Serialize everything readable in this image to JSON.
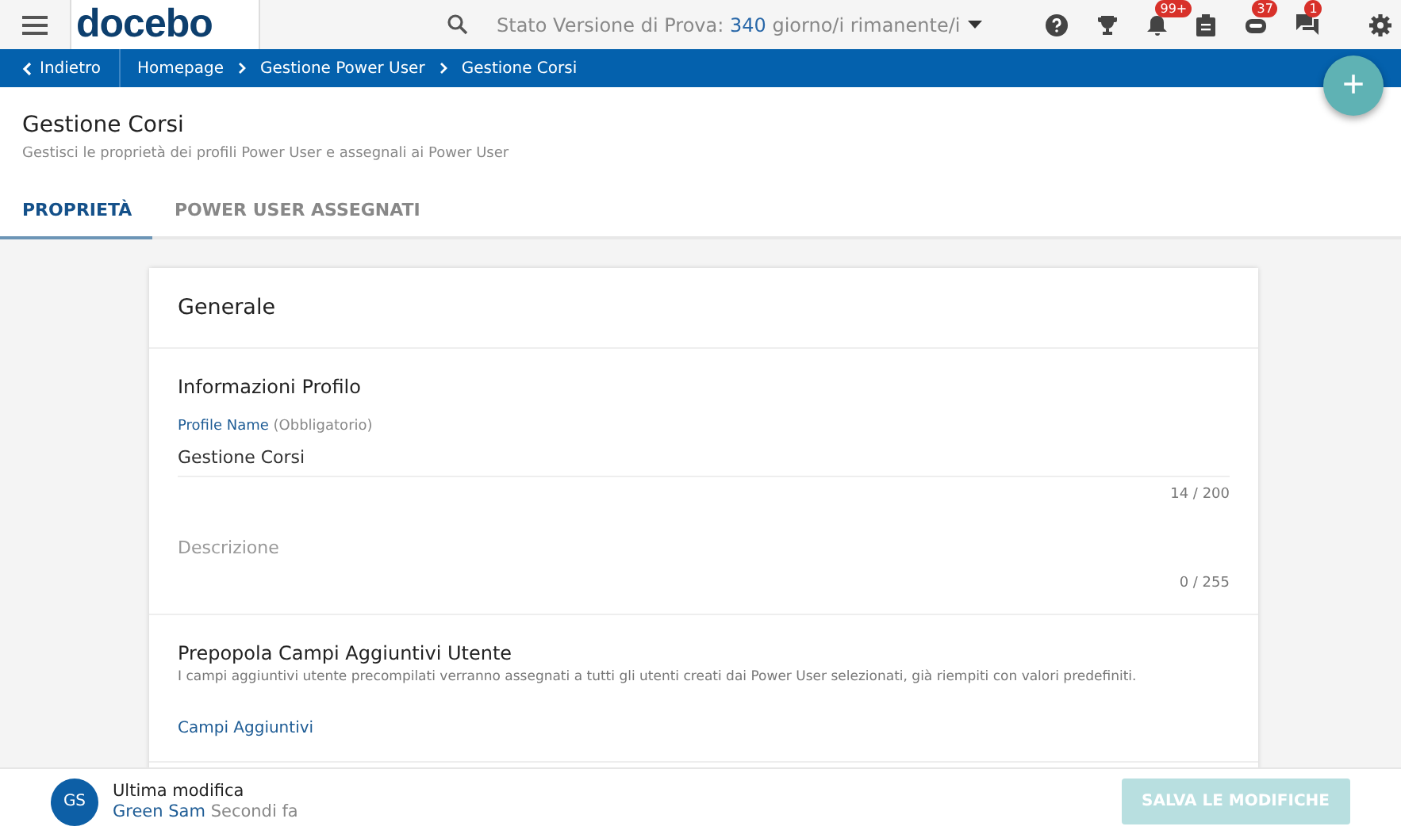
{
  "header": {
    "logo": "docebo",
    "trial": {
      "prefix": "Stato Versione di Prova:",
      "days": "340",
      "suffix": "giorno/i rimanente/i"
    },
    "icons": [
      {
        "kind": "help"
      },
      {
        "kind": "trophy"
      },
      {
        "kind": "bell",
        "badge": "99+"
      },
      {
        "kind": "clipboard"
      },
      {
        "kind": "bot",
        "badge": "37"
      },
      {
        "kind": "chat",
        "badge": "1"
      },
      {
        "kind": "settings"
      }
    ]
  },
  "breadcrumb": {
    "back": "Indietro",
    "items": [
      "Homepage",
      "Gestione Power User",
      "Gestione Corsi"
    ]
  },
  "fab": "+",
  "page": {
    "title": "Gestione Corsi",
    "subtitle": "Gestisci le proprietà dei profili Power User e assegnali ai Power User"
  },
  "tabs": [
    {
      "label": "PROPRIETÀ",
      "selected": true
    },
    {
      "label": "POWER USER ASSEGNATI",
      "selected": false
    }
  ],
  "card": {
    "title": "Generale",
    "profile": {
      "heading": "Informazioni Profilo",
      "name_label": "Profile Name",
      "name_hint": "(Obbligatorio)",
      "name_value": "Gestione Corsi",
      "name_count": "14 / 200",
      "description_placeholder": "Descrizione",
      "description_count": "0 / 255"
    },
    "extra": {
      "heading": "Prepopola Campi Aggiuntivi Utente",
      "text": "I campi aggiuntivi utente precompilati verranno assegnati a tutti gli utenti creati dai Power User selezionati, già riempiti con valori predefiniti.",
      "link": "Campi Aggiuntivi"
    }
  },
  "footer": {
    "initials": "GS",
    "label": "Ultima modifica",
    "user": "Green Sam",
    "time": "Secondi fa",
    "save": {
      "label": "SALVA LE MODIFICHE",
      "disabled": true
    }
  }
}
